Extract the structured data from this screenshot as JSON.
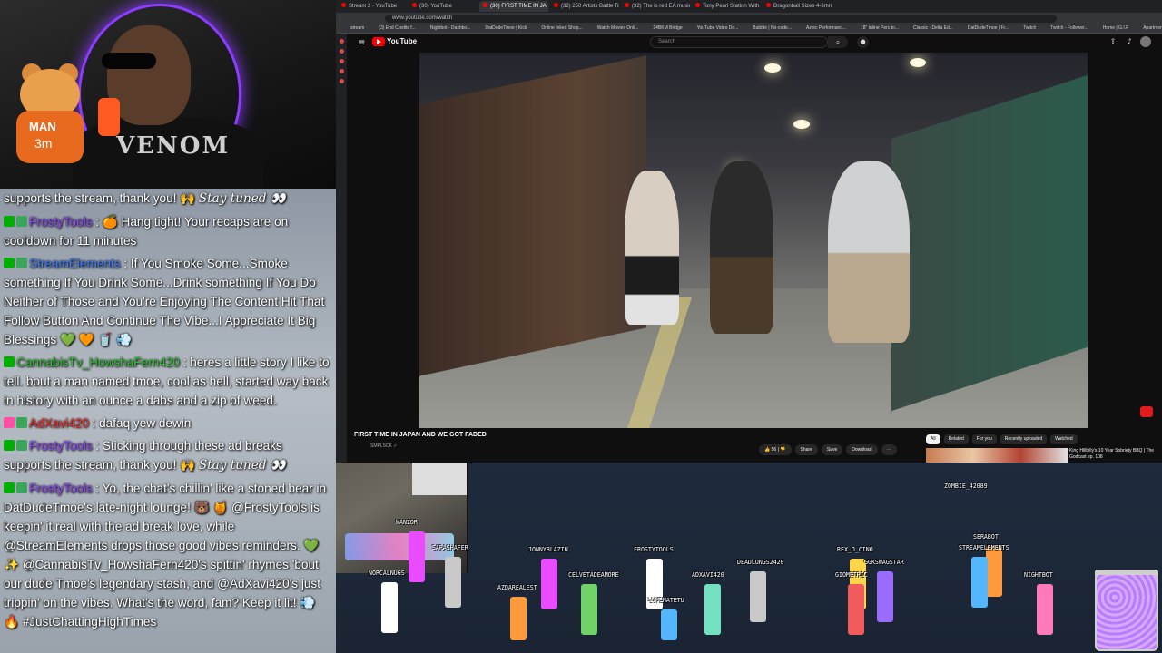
{
  "webcam": {
    "shirt_print": "VENOM",
    "mascot_text": "MAN",
    "mascot_subtext": "3m"
  },
  "chat": {
    "messages": [
      {
        "user": "",
        "text": "supports the stream, thank you! 🙌",
        "tail": "Stay tuned 👀",
        "badges": []
      },
      {
        "user": "FrostyTools",
        "sep": " : ",
        "text": "🍊 Hang tight! Your recaps are on cooldown for 11 minutes",
        "badges": [
          "mod",
          "vip"
        ],
        "color": "frosty"
      },
      {
        "user": "StreamElements",
        "sep": " : ",
        "text": "If You Smoke Some...Smoke something If You Drink Some...Drink something If You Do Neither of Those and You're Enjoying The Content Hit That Follow Button And Continue The Vibe...I Appreciate It Big Blessings 💚 🧡 🥤 💨",
        "badges": [
          "mod",
          "vip"
        ],
        "color": "se"
      },
      {
        "user": "CannabisTv_HowshaFern420",
        "sep": " : ",
        "text": "heres a little story I like to tell. bout a man named tmoe, cool as hell, started way back in history with an ounce a dabs and a zip of weed.",
        "badges": [
          "mod"
        ],
        "color": "cannabis"
      },
      {
        "user": "AdXavi420",
        "sep": " : ",
        "text": "dafaq yew dewin",
        "badges": [
          "sub",
          "vip"
        ],
        "color": "ad"
      },
      {
        "user": "FrostyTools",
        "sep": " : ",
        "text": "Sticking through these ad breaks supports the stream, thank you! 🙌",
        "tail": "Stay tuned 👀",
        "badges": [
          "mod",
          "vip"
        ],
        "color": "frosty"
      },
      {
        "user": "FrostyTools",
        "sep": " : ",
        "text": "Yo, the chat's chillin' like a stoned bear in DatDudeTmoe's late-night lounge! 🐻 🍯 @FrostyTools is keepin' it real with the ad break love, while @StreamElements drops those good vibes reminders. 💚 ✨ @CannabisTv_HowshaFern420's spittin' rhymes 'bout our dude Tmoe's legendary stash, and @AdXavi420's just trippin' on the vibes. What's the word, fam? Keep it lit! 💨 🔥 #JustChattingHighTimes",
        "badges": [
          "mod",
          "vip"
        ],
        "color": "frosty"
      }
    ]
  },
  "browser": {
    "tabs": [
      {
        "label": "Stream 2 - YouTube",
        "active": false
      },
      {
        "label": "(30) YouTube",
        "active": false
      },
      {
        "label": "(30) FIRST TIME IN JA",
        "active": true
      },
      {
        "label": "(32) 250 Artists Battle To",
        "active": false
      },
      {
        "label": "(32) The is red EA music",
        "active": false
      },
      {
        "label": "Tony Pearl Station With 2",
        "active": false
      },
      {
        "label": "Dragonball Sizes 4-6mm",
        "active": false
      }
    ],
    "url": "www.youtube.com/watch",
    "bookmarks": [
      "stream",
      "(3) End Credits f...",
      "Nightbot - Dashbo...",
      "DatDudeTmoe | Kick",
      "Online Inked Shop...",
      "Watch Movies Onli...",
      "24BKM Bridge",
      "YouTube Video Do...",
      "Bubble | No-code...",
      "Aztec Performanc...",
      "18\" Inline Perc to...",
      "Classic - Delta Ed...",
      "DatDudeTmoe | Fr...",
      "Twitch",
      "Twitch - Follower...",
      "Home | G.I.F",
      "Apartments | Late..."
    ]
  },
  "youtube": {
    "logo_text": "YouTube",
    "search_placeholder": "Search",
    "video_title": "FIRST TIME IN JAPAN AND WE GOT FADED",
    "channel": "SMPLSCK ✓",
    "like_count": "56",
    "actions": [
      "Share",
      "Save",
      "Download",
      "⋯"
    ],
    "chips": [
      "All",
      "Related",
      "For you",
      "Recently uploaded",
      "Watched"
    ],
    "rec_title": "King Hillbilly's 10 Year Sobriety BBQ | The Godcast ep. 108"
  },
  "scene": {
    "avatars": [
      {
        "name": "ZOMBIE_42089"
      },
      {
        "name": "SERABOT"
      },
      {
        "name": "STREAMELEMENTS"
      },
      {
        "name": "JONNYBLAZIN"
      },
      {
        "name": "FROSTYTOOLS"
      },
      {
        "name": "DEADLUNGS2420"
      },
      {
        "name": "REX_O_CINO"
      },
      {
        "name": "GGKSWAGSTAR"
      },
      {
        "name": "GIOMETRIC"
      },
      {
        "name": "NIGHTBOT"
      },
      {
        "name": "ADXAVI420"
      },
      {
        "name": "CELVETADEAMORE"
      },
      {
        "name": "AZDAREALEST"
      },
      {
        "name": "LUMENATETU"
      },
      {
        "name": "WANZOR"
      },
      {
        "name": "NORCALNUGS"
      },
      {
        "name": "SARASHAFER"
      }
    ]
  }
}
